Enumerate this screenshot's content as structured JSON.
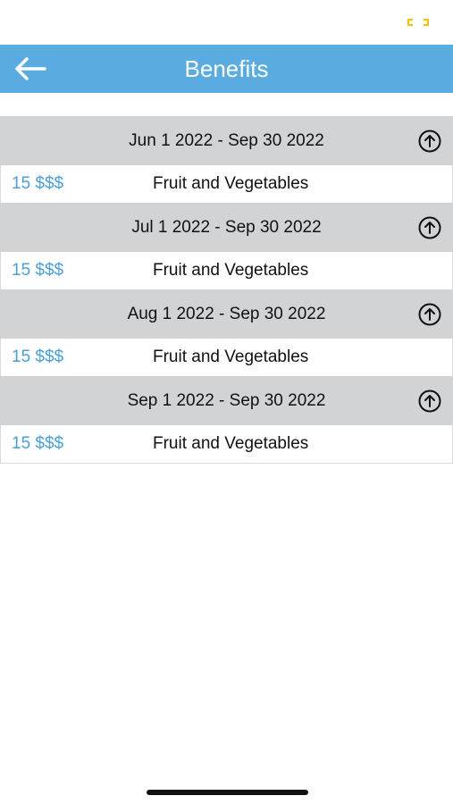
{
  "header": {
    "title": "Benefits",
    "back_icon": "arrow-left-icon"
  },
  "status_bar": {
    "indicator_color": "#f2c200"
  },
  "colors": {
    "header_bg": "#5aabe0",
    "group_bg": "#d2d3d4",
    "amount_text": "#4a9fd8"
  },
  "groups": [
    {
      "date_range": "Jun 1 2022 - Sep 30 2022",
      "collapse_icon": "arrow-up-circle-icon",
      "items": [
        {
          "amount": "15 $$$",
          "name": "Fruit and Vegetables"
        }
      ]
    },
    {
      "date_range": "Jul 1 2022 - Sep 30 2022",
      "collapse_icon": "arrow-up-circle-icon",
      "items": [
        {
          "amount": "15 $$$",
          "name": "Fruit and Vegetables"
        }
      ]
    },
    {
      "date_range": "Aug 1 2022 - Sep 30 2022",
      "collapse_icon": "arrow-up-circle-icon",
      "items": [
        {
          "amount": "15 $$$",
          "name": "Fruit and Vegetables"
        }
      ]
    },
    {
      "date_range": "Sep 1 2022 - Sep 30 2022",
      "collapse_icon": "arrow-up-circle-icon",
      "items": [
        {
          "amount": "15 $$$",
          "name": "Fruit and Vegetables"
        }
      ]
    }
  ]
}
